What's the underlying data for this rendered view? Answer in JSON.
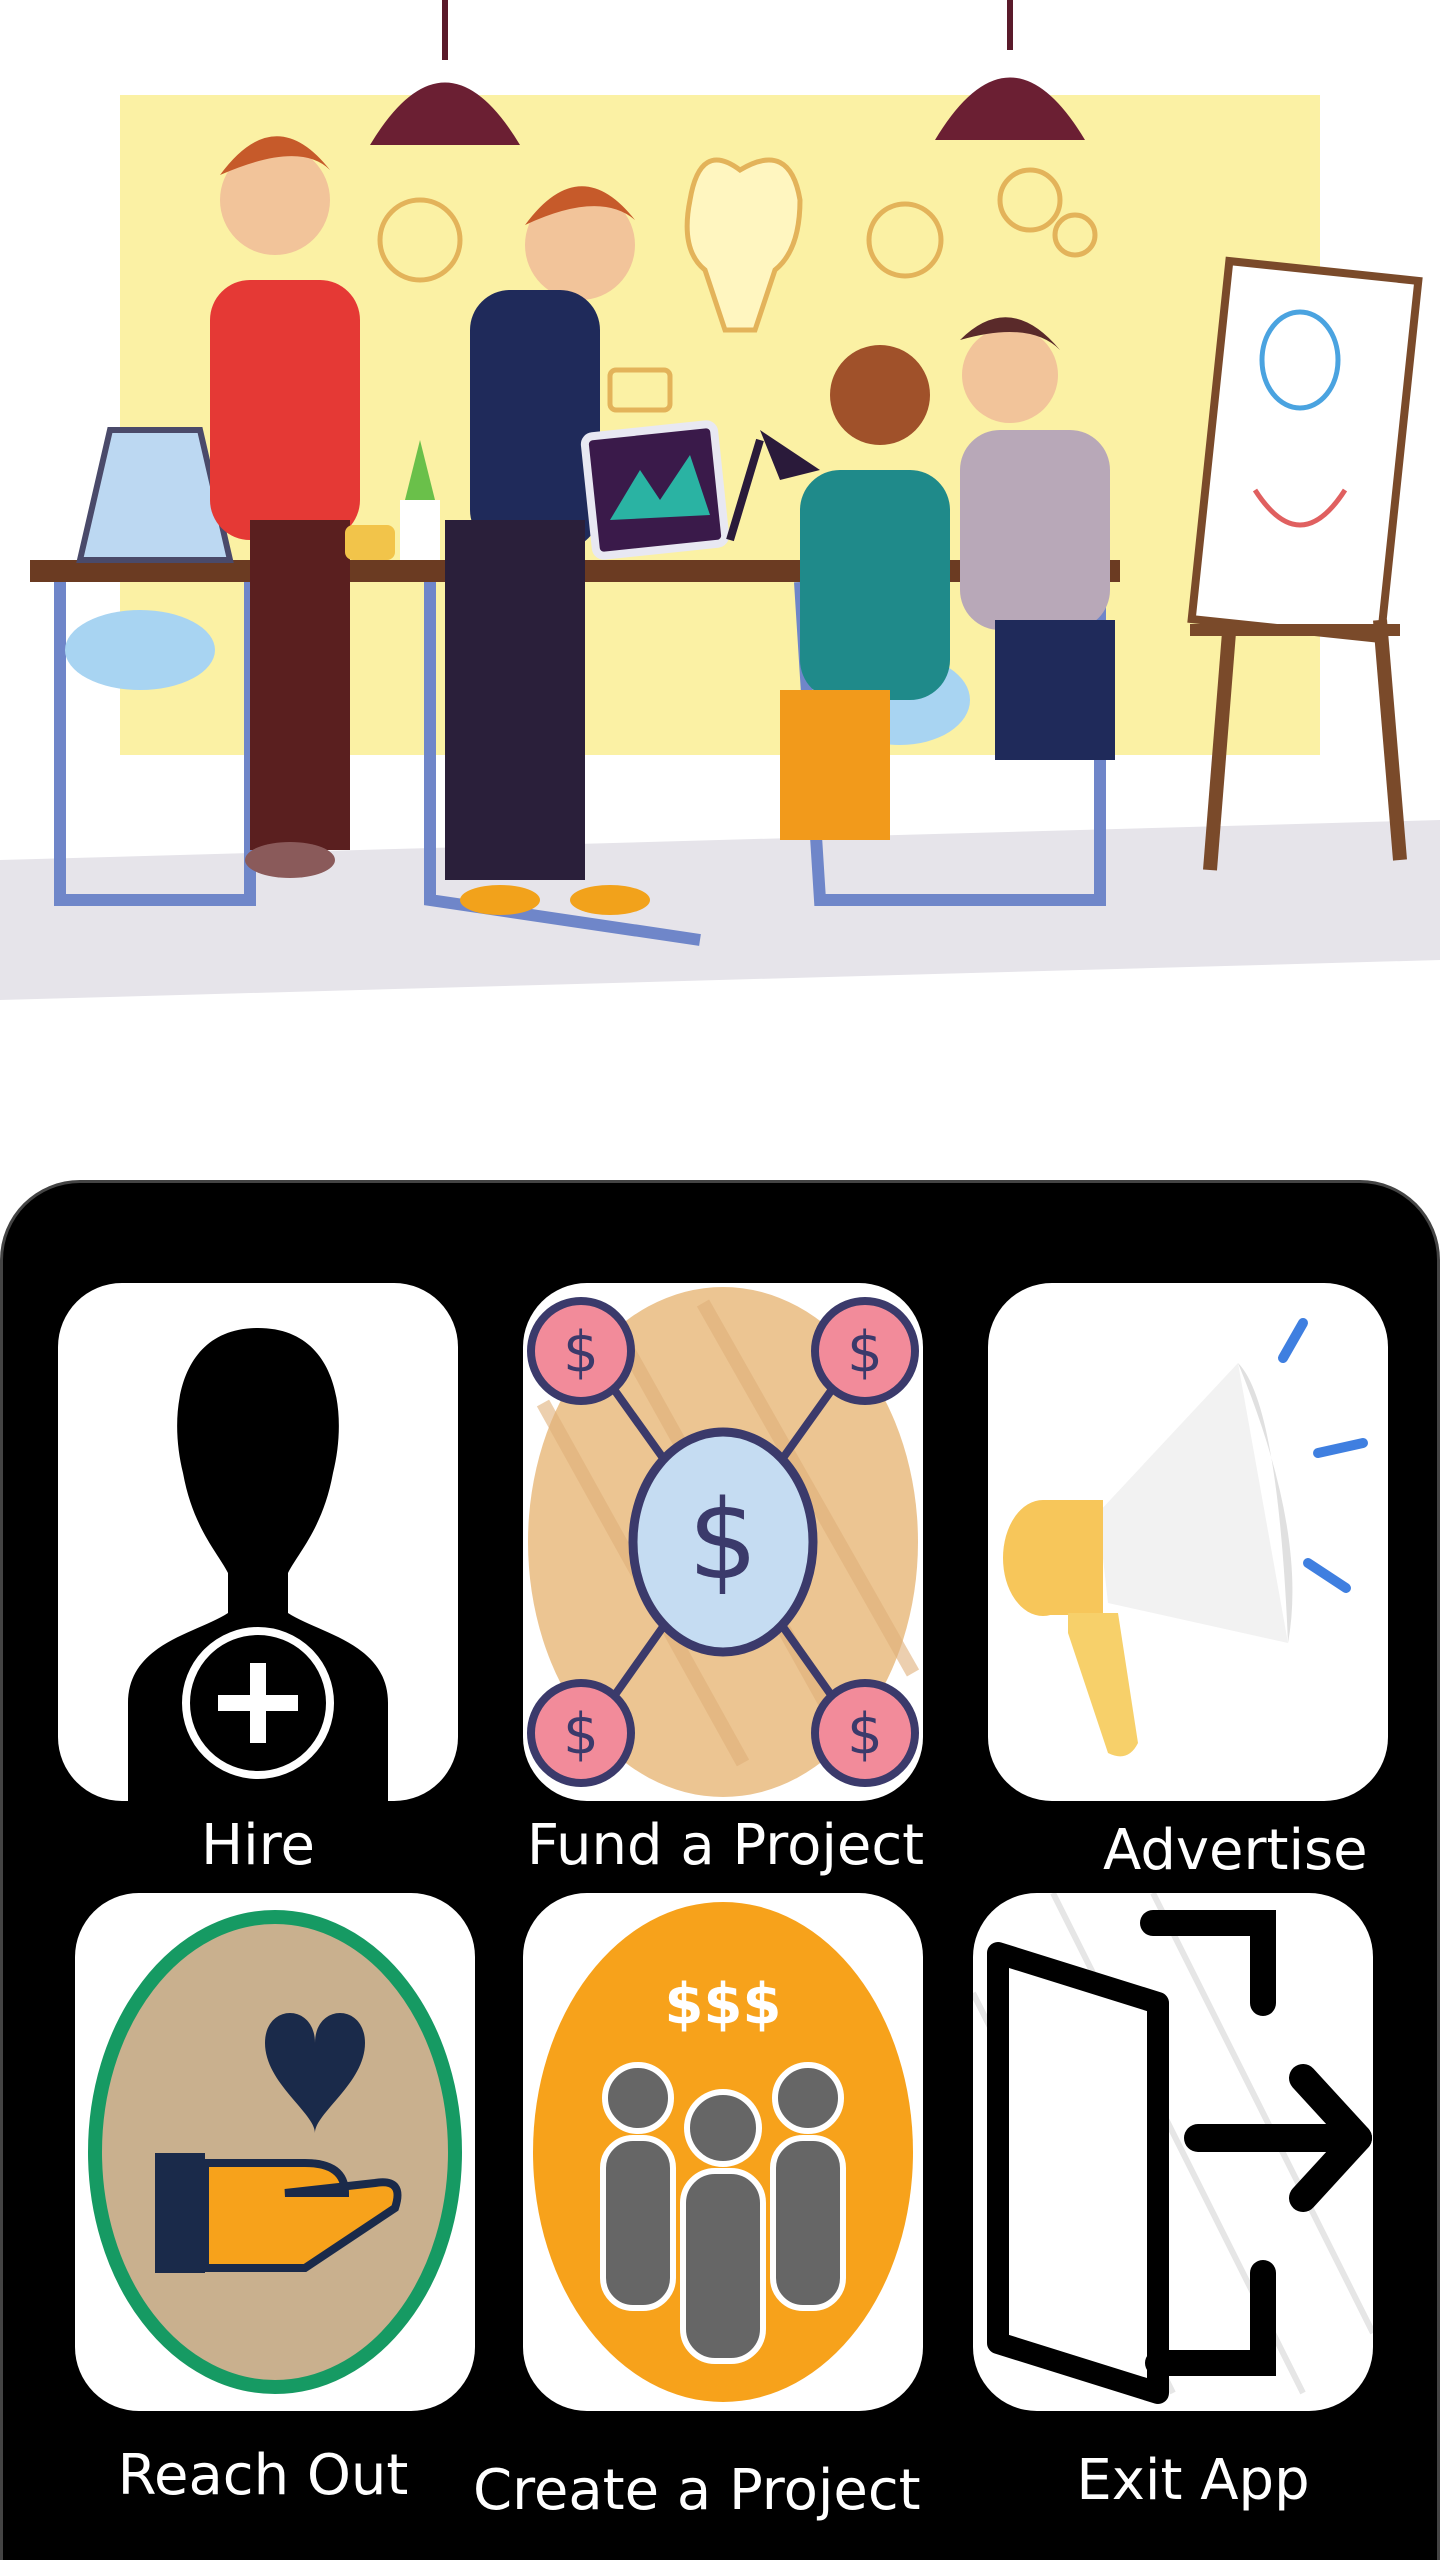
{
  "menu": {
    "hire": {
      "label": "Hire",
      "icon": "person-add-icon"
    },
    "fund": {
      "label": "Fund a Project",
      "icon": "money-network-icon",
      "symbol": "$"
    },
    "advertise": {
      "label": "Advertise",
      "icon": "megaphone-icon"
    },
    "reach_out": {
      "label": "Reach Out",
      "icon": "hand-heart-icon"
    },
    "create_project": {
      "label": "Create a Project",
      "icon": "team-money-icon",
      "symbol": "$$$"
    },
    "exit": {
      "label": "Exit App",
      "icon": "exit-door-icon"
    }
  },
  "colors": {
    "panel": "#000000",
    "tile": "#ffffff",
    "label": "#ffffff",
    "wall": "#fbf1a4",
    "accent_orange": "#f7a21b",
    "accent_pink": "#f28b9a",
    "accent_green": "#169a63"
  }
}
